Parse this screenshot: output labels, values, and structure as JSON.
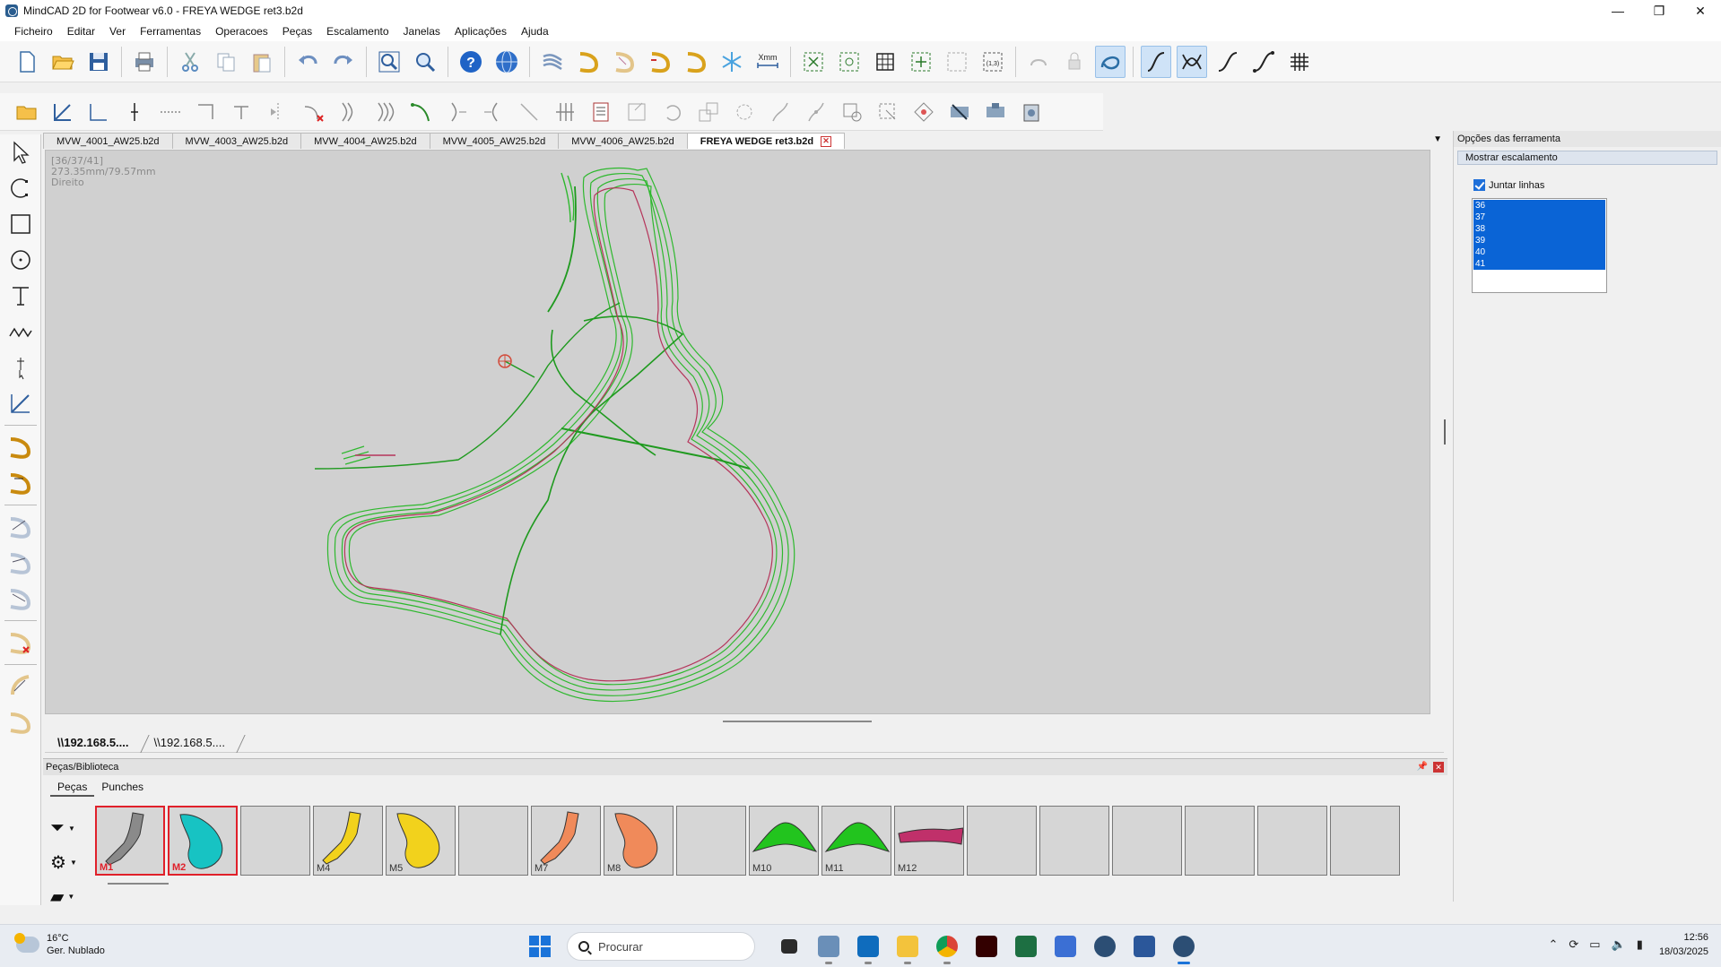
{
  "window": {
    "title": "MindCAD 2D for Footwear v6.0 - FREYA WEDGE ret3.b2d",
    "controls": [
      "—",
      "❐",
      "✕"
    ]
  },
  "menu": [
    "Ficheiro",
    "Editar",
    "Ver",
    "Ferramentas",
    "Operacoes",
    "Peças",
    "Escalamento",
    "Janelas",
    "Aplicações",
    "Ajuda"
  ],
  "toolbar_top": {
    "xmm_label": "Xmm",
    "ratio_label": "(1,3)"
  },
  "doc_tabs": [
    {
      "label": "MVW_4001_AW25.b2d",
      "active": false
    },
    {
      "label": "MVW_4003_AW25.b2d",
      "active": false
    },
    {
      "label": "MVW_4004_AW25.b2d",
      "active": false
    },
    {
      "label": "MVW_4005_AW25.b2d",
      "active": false
    },
    {
      "label": "MVW_4006_AW25.b2d",
      "active": false
    },
    {
      "label": "FREYA WEDGE ret3.b2d",
      "active": true
    }
  ],
  "canvas_info": {
    "sizes": "[36/37/41]",
    "measure": "273.35mm/79.57mm",
    "side": "Direito"
  },
  "path_tabs": [
    {
      "label": "\\\\192.168.5....",
      "active": true
    },
    {
      "label": "\\\\192.168.5....",
      "active": false
    }
  ],
  "right_panel": {
    "title": "Opções das ferramenta",
    "section": "Mostrar escalamento",
    "checkbox_label": "Juntar linhas",
    "checkbox_checked": true,
    "sizes": [
      "36",
      "37",
      "38",
      "39",
      "40",
      "41"
    ]
  },
  "library": {
    "title": "Peças/Biblioteca",
    "tabs": [
      "Peças",
      "Punches"
    ],
    "pieces": [
      {
        "label": "M1",
        "color": "#8a8a8a",
        "shape": "boot",
        "selected": true
      },
      {
        "label": "M2",
        "color": "#17c3c3",
        "shape": "blob",
        "selected": true
      },
      {
        "label": "",
        "color": "",
        "shape": "",
        "selected": false
      },
      {
        "label": "M4",
        "color": "#f2d21c",
        "shape": "boot",
        "selected": false
      },
      {
        "label": "M5",
        "color": "#f2d21c",
        "shape": "blob",
        "selected": false
      },
      {
        "label": "",
        "color": "",
        "shape": "",
        "selected": false
      },
      {
        "label": "M7",
        "color": "#f08a5a",
        "shape": "boot",
        "selected": false
      },
      {
        "label": "M8",
        "color": "#f08a5a",
        "shape": "blob",
        "selected": false
      },
      {
        "label": "",
        "color": "",
        "shape": "",
        "selected": false
      },
      {
        "label": "M10",
        "color": "#22c41e",
        "shape": "arch",
        "selected": false
      },
      {
        "label": "M11",
        "color": "#22c41e",
        "shape": "arch",
        "selected": false
      },
      {
        "label": "M12",
        "color": "#c0306a",
        "shape": "strip",
        "selected": false
      },
      {
        "label": "",
        "color": "",
        "shape": "",
        "selected": false
      },
      {
        "label": "",
        "color": "",
        "shape": "",
        "selected": false
      },
      {
        "label": "",
        "color": "",
        "shape": "",
        "selected": false
      },
      {
        "label": "",
        "color": "",
        "shape": "",
        "selected": false
      },
      {
        "label": "",
        "color": "",
        "shape": "",
        "selected": false
      },
      {
        "label": "",
        "color": "",
        "shape": "",
        "selected": false
      }
    ]
  },
  "taskbar": {
    "weather_temp": "16°C",
    "weather_desc": "Ger. Nublado",
    "search_placeholder": "Procurar",
    "time": "12:56",
    "date": "18/03/2025"
  }
}
